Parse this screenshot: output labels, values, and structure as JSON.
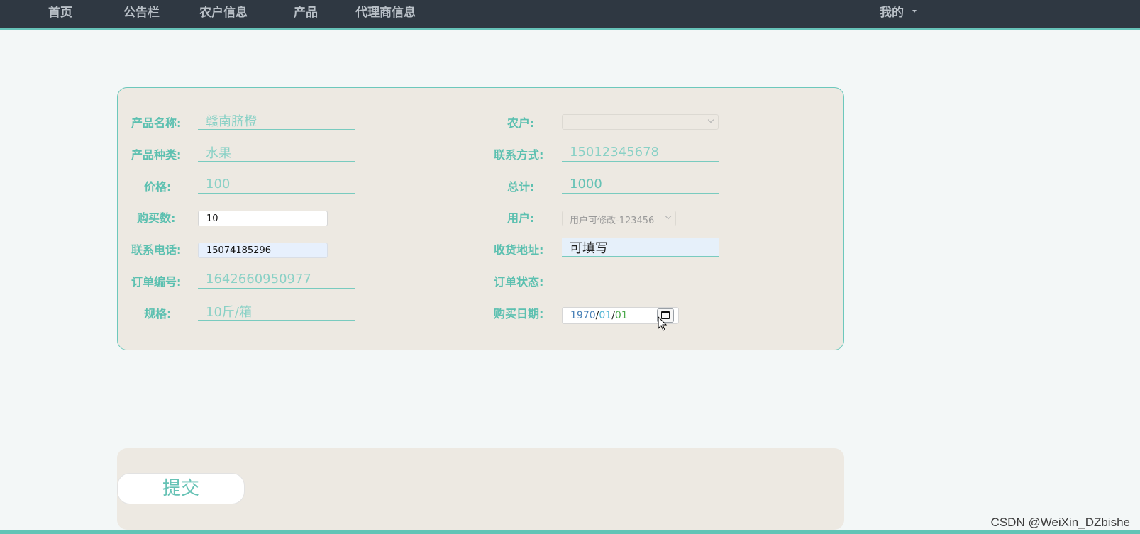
{
  "nav": {
    "items": [
      "首页",
      "公告栏",
      "农户信息",
      "产品",
      "代理商信息"
    ],
    "user_menu": "我的"
  },
  "form": {
    "left": [
      {
        "label": "产品名称:",
        "value": "赣南脐橙"
      },
      {
        "label": "产品种类:",
        "value": "水果"
      },
      {
        "label": "价格:",
        "value": "100"
      },
      {
        "label": "购买数:",
        "value": "10"
      },
      {
        "label": "联系电话:",
        "value": "15074185296"
      },
      {
        "label": "订单编号:",
        "value": "1642660950977"
      },
      {
        "label": "规格:",
        "value": "10斤/箱"
      }
    ],
    "right": [
      {
        "label": "农户:",
        "value": ""
      },
      {
        "label": "联系方式:",
        "value": "15012345678"
      },
      {
        "label": "总计:",
        "value": "1000"
      },
      {
        "label": "用户:",
        "value": "用户可修改-123456"
      },
      {
        "label": "收货地址:",
        "value": "可填写"
      },
      {
        "label": "订单状态:",
        "value": ""
      },
      {
        "label": "购买日期:",
        "value": "1970/01/01"
      }
    ],
    "date": {
      "year": "1970",
      "month": "01",
      "day": "01",
      "sep": "/"
    }
  },
  "actions": {
    "submit_label": "提交"
  },
  "watermark": "CSDN @WeiXin_DZbishe",
  "colors": {
    "nav_bg": "#2f3842",
    "accent": "#5cc0b0",
    "panel_bg": "#ede9e2",
    "page_bg": "#f3f7f7"
  }
}
